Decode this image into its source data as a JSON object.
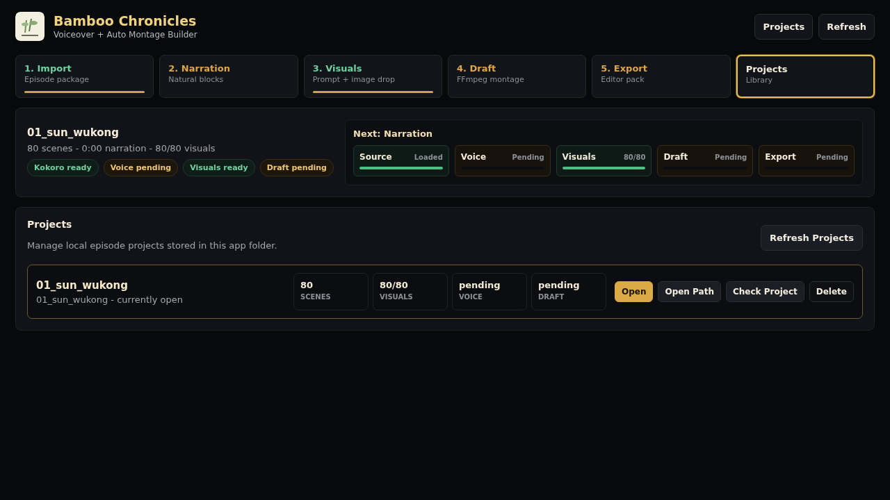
{
  "app": {
    "title": "Bamboo Chronicles",
    "subtitle": "Voiceover + Auto Montage Builder"
  },
  "header_buttons": [
    "Projects",
    "Refresh"
  ],
  "steps": [
    {
      "title": "1. Import",
      "subtitle": "Episode package",
      "kind": "done",
      "level": 1,
      "selected": false
    },
    {
      "title": "2. Narration",
      "subtitle": "Natural blocks",
      "kind": "pending",
      "selected": false
    },
    {
      "title": "3. Visuals",
      "subtitle": "Prompt + image drop",
      "kind": "done",
      "level": 1,
      "selected": false
    },
    {
      "title": "4. Draft",
      "subtitle": "FFmpeg montage",
      "kind": "pending",
      "selected": false
    },
    {
      "title": "5. Export",
      "subtitle": "Editor pack",
      "kind": "pending",
      "selected": false
    },
    {
      "title": "Projects",
      "subtitle": "Library",
      "kind": "neutral",
      "selected": true
    }
  ],
  "episode": {
    "name": "01_sun_wukong",
    "summary": "80 scenes - 0:00 narration - 80/80 visuals",
    "chips": [
      {
        "label": "Kokoro ready",
        "kind": "ok"
      },
      {
        "label": "Voice pending",
        "kind": "warn"
      },
      {
        "label": "Visuals ready",
        "kind": "ok"
      },
      {
        "label": "Draft pending",
        "kind": "warn"
      }
    ],
    "next": "Next: Narration",
    "stages": [
      {
        "name": "Source",
        "status": "Loaded",
        "kind": "ok",
        "level": 1
      },
      {
        "name": "Voice",
        "status": "Pending",
        "kind": "warn"
      },
      {
        "name": "Visuals",
        "status": "80/80",
        "kind": "ok",
        "level": 1
      },
      {
        "name": "Draft",
        "status": "Pending",
        "kind": "warn"
      },
      {
        "name": "Export",
        "status": "Pending",
        "kind": "warn"
      }
    ]
  },
  "projects": {
    "title": "Projects",
    "description": "Manage local episode projects stored in this app folder.",
    "refresh_button": "Refresh Projects",
    "items": [
      {
        "name": "01_sun_wukong",
        "detail": "01_sun_wukong - currently open",
        "current": true,
        "stats": [
          {
            "value": "80",
            "label": "SCENES"
          },
          {
            "value": "80/80",
            "label": "VISUALS"
          },
          {
            "value": "pending",
            "label": "VOICE"
          },
          {
            "value": "pending",
            "label": "DRAFT"
          }
        ],
        "actions": [
          {
            "label": "Open",
            "kind": "primary"
          },
          {
            "label": "Open Path",
            "kind": "secondary"
          },
          {
            "label": "Check Project",
            "kind": "secondary"
          },
          {
            "label": "Delete",
            "kind": "dark"
          }
        ]
      }
    ]
  }
}
